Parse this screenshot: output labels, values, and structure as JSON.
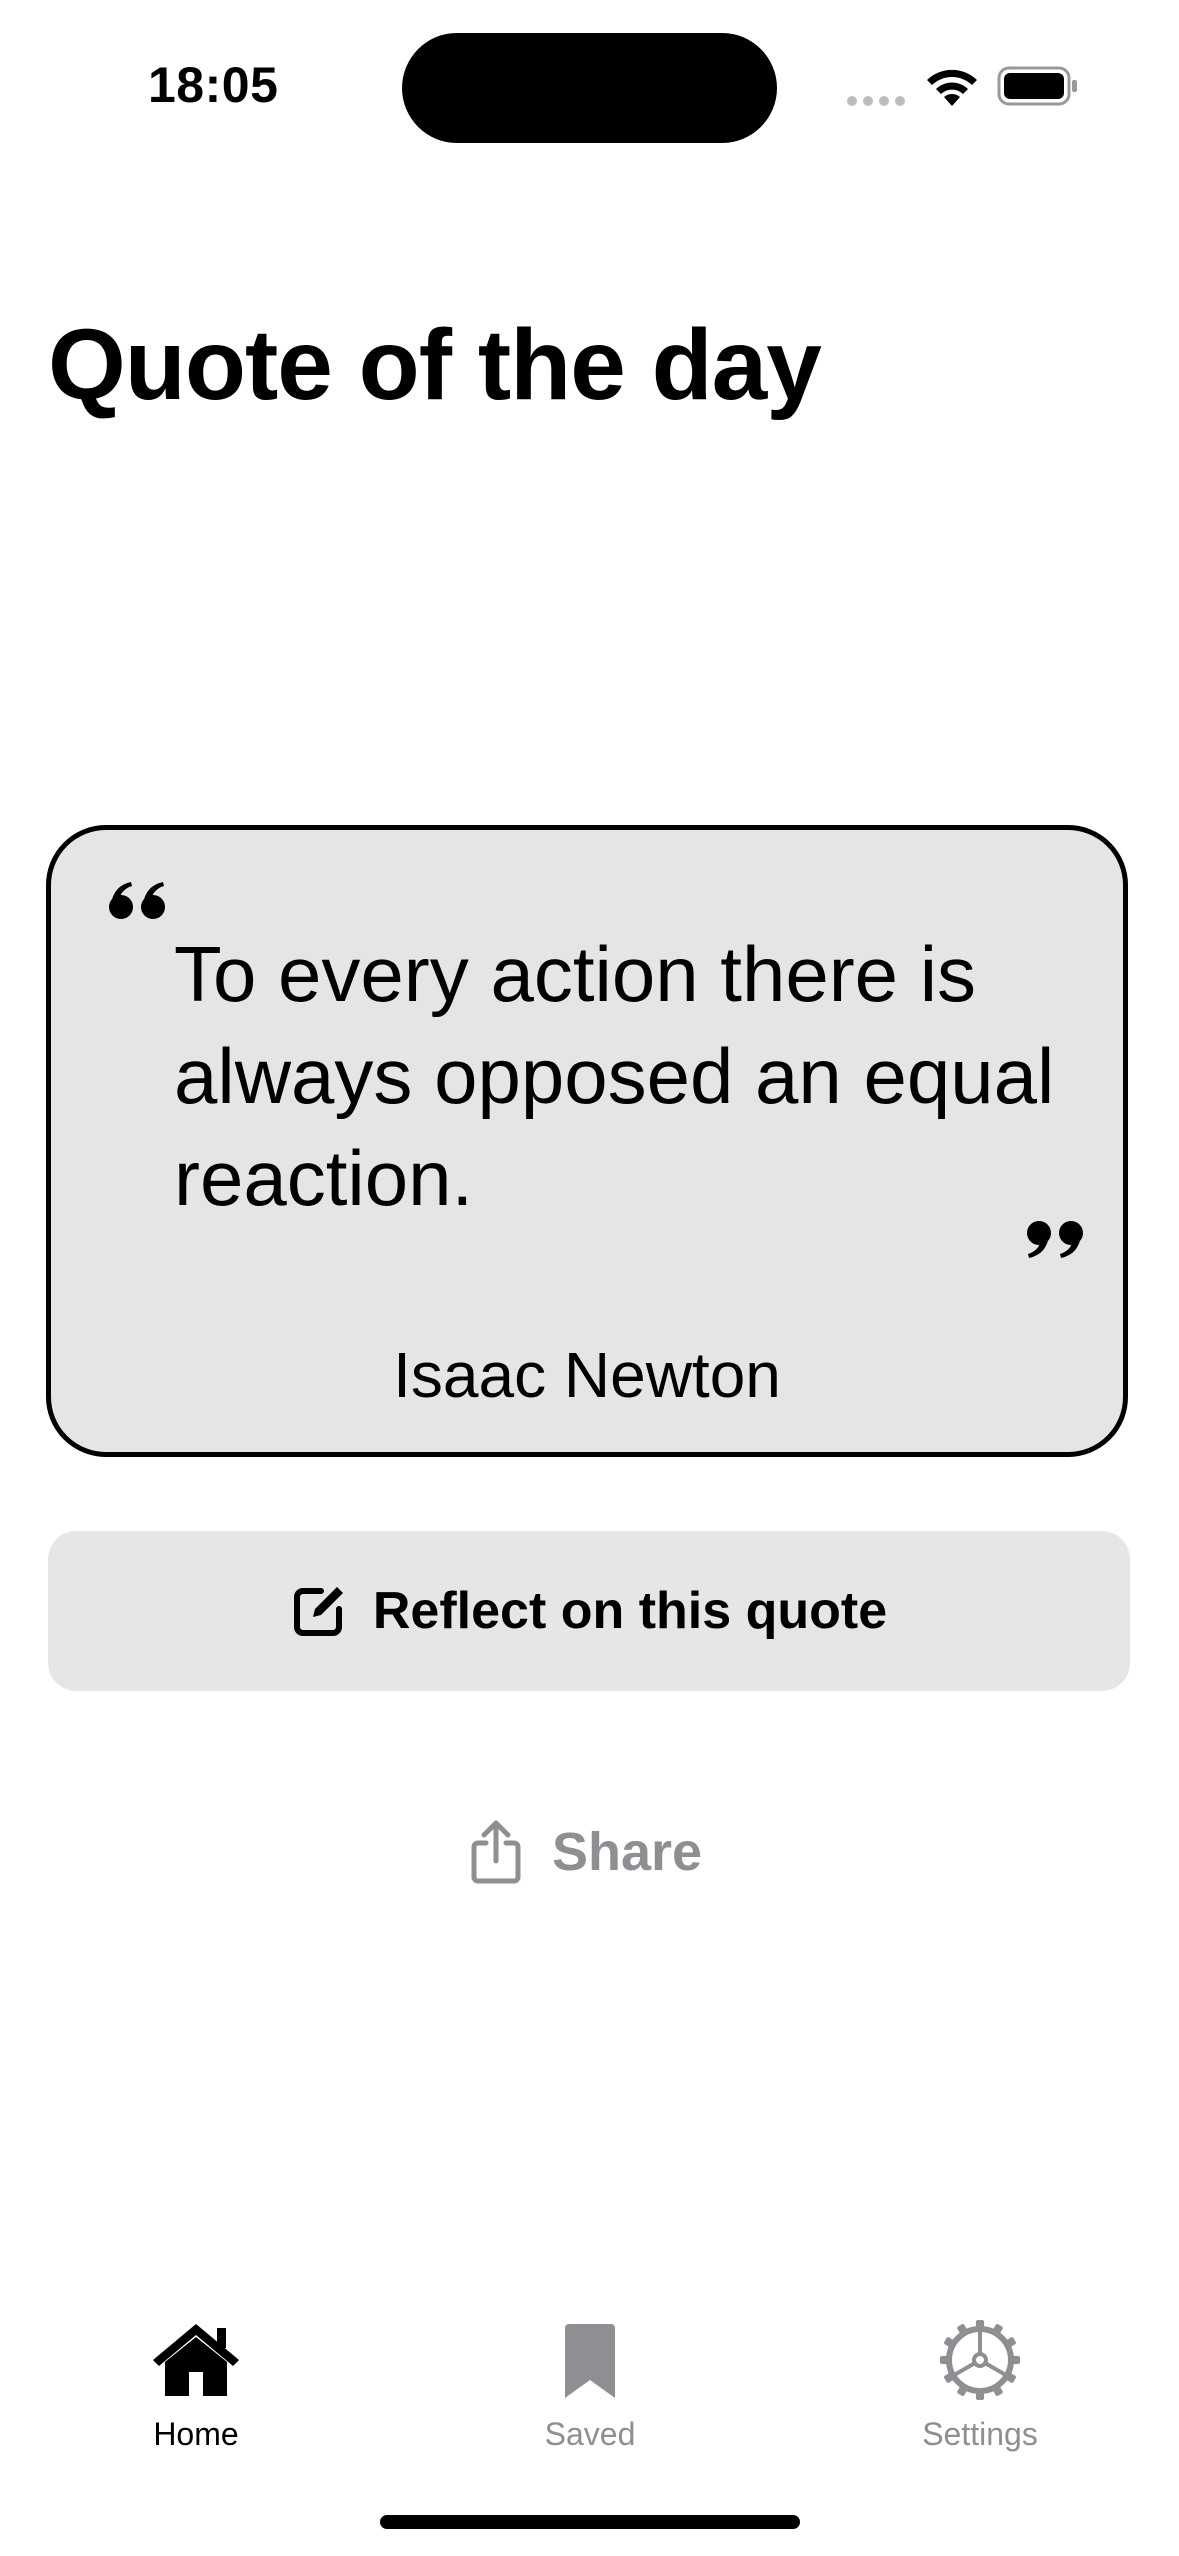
{
  "status_bar": {
    "time": "18:05",
    "icons": [
      "cellular-signal-icon",
      "wifi-icon",
      "battery-icon"
    ]
  },
  "header": {
    "title": "Quote of the day"
  },
  "quote_card": {
    "text": "To every action there is always opposed an equal reaction.",
    "author": "Isaac Newton",
    "icons": [
      "open-quote-icon",
      "close-quote-icon"
    ]
  },
  "actions": {
    "reflect_label": "Reflect on this quote",
    "reflect_icon": "compose-icon",
    "share_label": "Share",
    "share_icon": "share-icon"
  },
  "tab_bar": {
    "items": [
      {
        "label": "Home",
        "icon": "house-icon",
        "selected": true
      },
      {
        "label": "Saved",
        "icon": "bookmark-icon",
        "selected": false
      },
      {
        "label": "Settings",
        "icon": "gear-icon",
        "selected": false
      }
    ]
  },
  "colors": {
    "background": "#ffffff",
    "card_background": "#e5e5e5",
    "button_background": "#e6e6e6",
    "secondary_text": "#8e8e93",
    "primary_text": "#000000"
  }
}
